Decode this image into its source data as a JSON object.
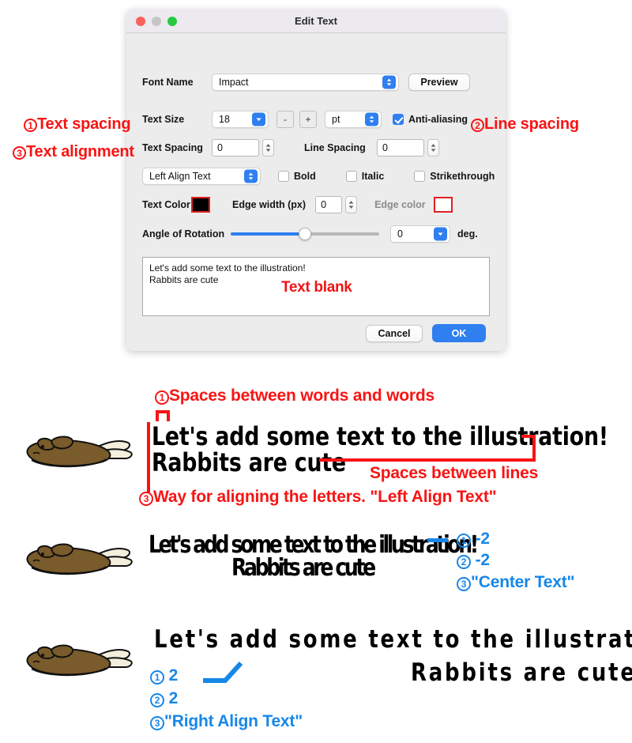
{
  "dialog": {
    "title": "Edit Text",
    "traffic_lights": [
      "close",
      "minimize",
      "zoom"
    ],
    "font_name": {
      "label": "Font Name",
      "value": "Impact"
    },
    "preview_button": "Preview",
    "text_size": {
      "label": "Text Size",
      "value": "18"
    },
    "minus_button": "-",
    "plus_button": "+",
    "unit": {
      "value": "pt"
    },
    "anti_aliasing": {
      "label": "Anti-aliasing",
      "checked": true
    },
    "text_spacing": {
      "label": "Text Spacing",
      "value": "0"
    },
    "line_spacing": {
      "label": "Line Spacing",
      "value": "0"
    },
    "alignment": {
      "value": "Left Align Text"
    },
    "bold": {
      "label": "Bold",
      "checked": false
    },
    "italic": {
      "label": "Italic",
      "checked": false
    },
    "strikethrough": {
      "label": "Strikethrough",
      "checked": false
    },
    "text_color": {
      "label": "Text Color",
      "color": "#000000"
    },
    "edge_width": {
      "label": "Edge width (px)",
      "value": "0"
    },
    "edge_color": {
      "label": "Edge color",
      "color": "#ffffff"
    },
    "angle": {
      "label": "Angle of Rotation",
      "value": "0",
      "unit": "deg.",
      "percent": 50
    },
    "textarea": {
      "line1": "Let's add some text to the illustration!",
      "line2": "Rabbits are cute"
    },
    "textarea_note": "Text blank",
    "cancel_button": "Cancel",
    "ok_button": "OK"
  },
  "callouts": {
    "text_spacing": {
      "num": "1",
      "label": "Text spacing"
    },
    "line_spacing": {
      "num": "2",
      "label": "Line spacing"
    },
    "text_alignment": {
      "num": "3",
      "label": "Text alignment"
    }
  },
  "samples": [
    {
      "num_words": "1",
      "words_label": "Spaces between words and words",
      "line1": "Let's add some text to the illustration!",
      "line2": "Rabbits are cute",
      "lines_label": "Spaces between lines",
      "align_num": "3",
      "align_label": "Way for aligning the letters. \"Left Align Text\"",
      "alt": "brown lop-eared rabbit lying down"
    },
    {
      "line1": "Let's add some text to the illustration!",
      "line2": "Rabbits are cute",
      "items": [
        {
          "num": "1",
          "value": "-2"
        },
        {
          "num": "2",
          "value": "-2"
        },
        {
          "num": "3",
          "value": "\"Center Text\""
        }
      ],
      "alt": "brown lop-eared rabbit lying down"
    },
    {
      "line1": "Let's add some text to the illustration!",
      "line2": "Rabbits are cute",
      "items": [
        {
          "num": "1",
          "value": "2"
        },
        {
          "num": "2",
          "value": "2"
        },
        {
          "num": "3",
          "value": "\"Right Align Text\""
        }
      ],
      "alt": "brown lop-eared rabbit lying down"
    }
  ],
  "colors": {
    "annotation_red": "#f81414",
    "annotation_blue": "#1787e8",
    "accent_blue": "#2f7ff0",
    "rabbit_body": "#7a5b2b",
    "rabbit_belly": "#f2ecd9"
  }
}
